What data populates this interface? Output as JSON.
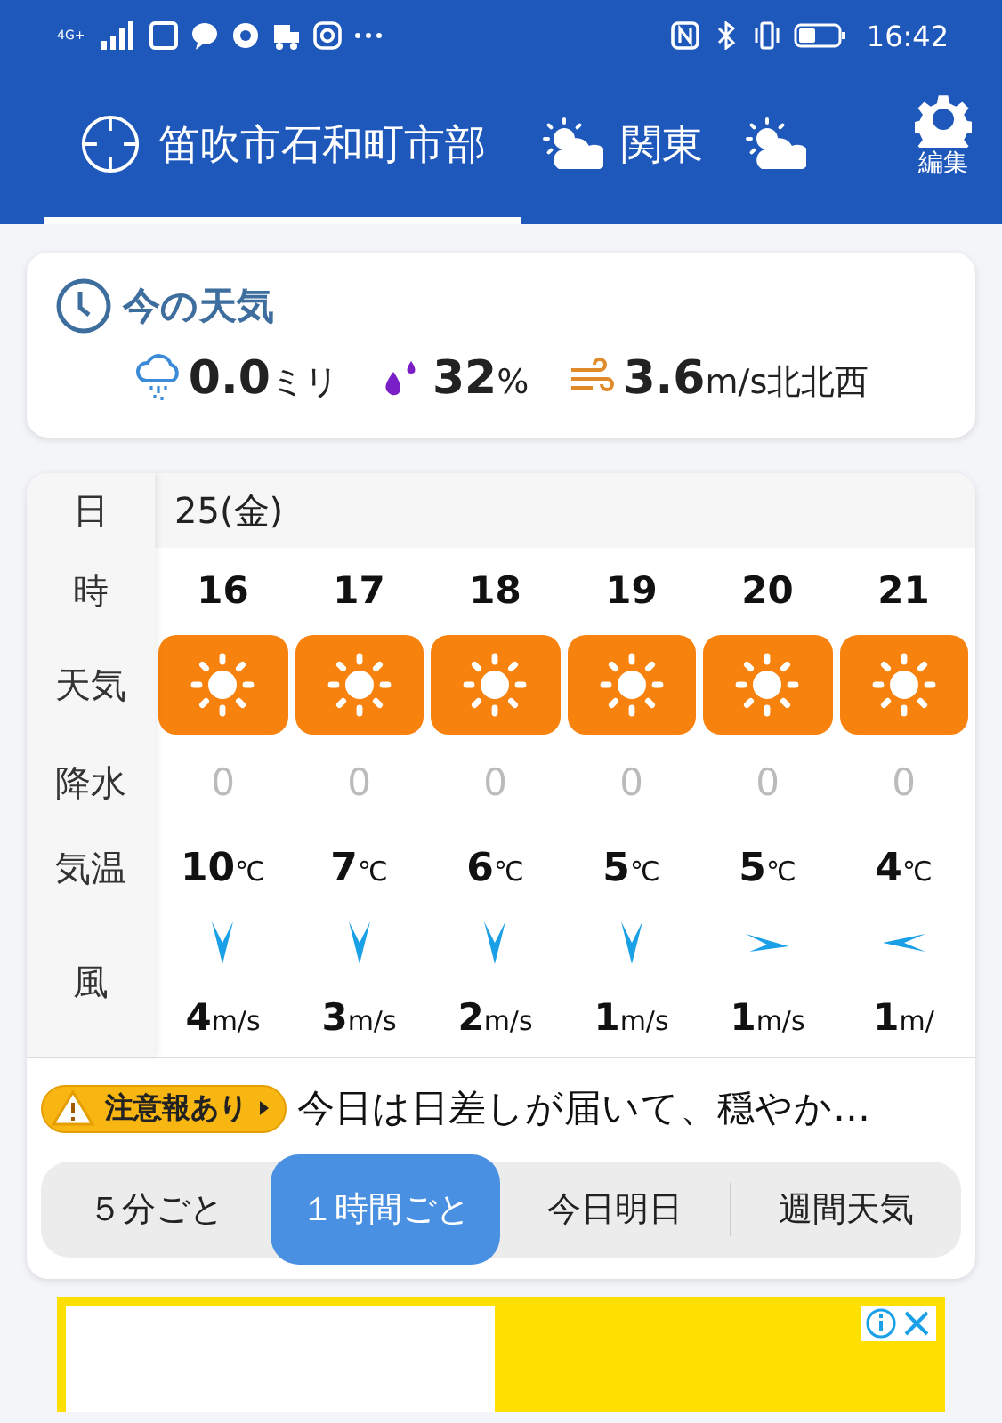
{
  "status_bar": {
    "network": "4G+",
    "time": "16:42"
  },
  "location_tabs": [
    {
      "label": "笛吹市石和町市部",
      "kind": "location",
      "selected": true
    },
    {
      "label": "関東",
      "kind": "region",
      "selected": false
    },
    {
      "kind": "region",
      "selected": false
    }
  ],
  "edit_button": {
    "label": "編集"
  },
  "current_weather": {
    "title": "今の天気",
    "precipitation": {
      "value": "0.0",
      "unit": "ミリ"
    },
    "humidity": {
      "value": "32",
      "unit": "%"
    },
    "wind": {
      "value": "3.6",
      "unit": "m/s",
      "direction": "北北西"
    }
  },
  "forecast": {
    "row_labels": {
      "date": "日",
      "hour": "時",
      "weather": "天気",
      "precipitation": "降水",
      "temperature": "気温",
      "wind": "風"
    },
    "date": "25(金)",
    "hours": [
      {
        "hour": "16",
        "weather": {
          "kind": "sunny"
        },
        "precipitation": "0",
        "temperature": "10",
        "temp_unit": "℃",
        "wind_arrow": {
          "kind": "south"
        },
        "wind_speed": "4",
        "wind_unit": "m/s"
      },
      {
        "hour": "17",
        "weather": {
          "kind": "sunny"
        },
        "precipitation": "0",
        "temperature": "7",
        "temp_unit": "℃",
        "wind_arrow": {
          "kind": "south"
        },
        "wind_speed": "3",
        "wind_unit": "m/s"
      },
      {
        "hour": "18",
        "weather": {
          "kind": "sunny"
        },
        "precipitation": "0",
        "temperature": "6",
        "temp_unit": "℃",
        "wind_arrow": {
          "kind": "south"
        },
        "wind_speed": "2",
        "wind_unit": "m/s"
      },
      {
        "hour": "19",
        "weather": {
          "kind": "sunny"
        },
        "precipitation": "0",
        "temperature": "5",
        "temp_unit": "℃",
        "wind_arrow": {
          "kind": "south"
        },
        "wind_speed": "1",
        "wind_unit": "m/s"
      },
      {
        "hour": "20",
        "weather": {
          "kind": "sunny"
        },
        "precipitation": "0",
        "temperature": "5",
        "temp_unit": "℃",
        "wind_arrow": {
          "kind": "east"
        },
        "wind_speed": "1",
        "wind_unit": "m/s"
      },
      {
        "hour": "21",
        "weather": {
          "kind": "sunny"
        },
        "precipitation": "0",
        "temperature": "4",
        "temp_unit": "℃",
        "wind_arrow": {
          "kind": "west"
        },
        "wind_speed": "1",
        "wind_unit": "m/"
      }
    ]
  },
  "alert": {
    "badge": "注意報あり",
    "text": "今日は日差しが届いて、穏やか…"
  },
  "period_tabs": [
    {
      "label": "５分ごと",
      "selected": false
    },
    {
      "label": "１時間ごと",
      "selected": true
    },
    {
      "label": "今日明日",
      "selected": false
    },
    {
      "label": "週間天気",
      "selected": false
    }
  ]
}
